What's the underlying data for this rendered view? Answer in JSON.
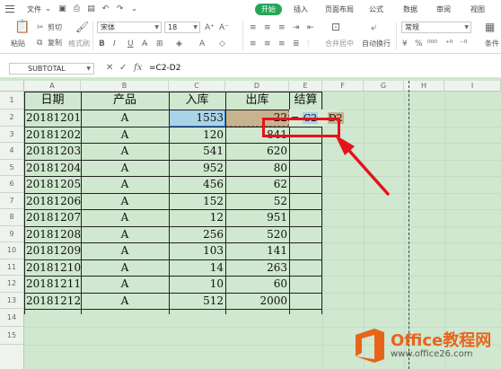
{
  "menubar": {
    "file_label": "文件",
    "tabs": [
      {
        "label": "开始",
        "active": true
      },
      {
        "label": "插入",
        "active": false
      },
      {
        "label": "页面布局",
        "active": false
      },
      {
        "label": "公式",
        "active": false
      },
      {
        "label": "数据",
        "active": false
      },
      {
        "label": "审阅",
        "active": false
      },
      {
        "label": "视图",
        "active": false
      }
    ]
  },
  "ribbon": {
    "paste_label": "粘贴",
    "cut_label": "剪切",
    "copy_label": "复制",
    "format_painter_label": "格式刷",
    "font_name": "宋体",
    "font_size": "18",
    "merge_label": "合并居中",
    "wrap_label": "自动换行",
    "number_format": "常规",
    "condition_label": "条件"
  },
  "formula_bar": {
    "name_box": "SUBTOTAL",
    "fx_label": "fx",
    "formula": "=C2-D2"
  },
  "columns": [
    "A",
    "B",
    "C",
    "D",
    "E",
    "F",
    "G",
    "H",
    "I"
  ],
  "rows": [
    "1",
    "2",
    "3",
    "4",
    "5",
    "6",
    "7",
    "8",
    "9",
    "10",
    "11",
    "12",
    "13",
    "14",
    "15"
  ],
  "table": {
    "headers": [
      "日期",
      "产品",
      "入库",
      "出库",
      "结算"
    ],
    "data": [
      [
        "20181201",
        "A",
        "1553",
        "22"
      ],
      [
        "20181202",
        "A",
        "120",
        "841"
      ],
      [
        "20181203",
        "A",
        "541",
        "620"
      ],
      [
        "20181204",
        "A",
        "952",
        "80"
      ],
      [
        "20181205",
        "A",
        "456",
        "62"
      ],
      [
        "20181206",
        "A",
        "152",
        "52"
      ],
      [
        "20181207",
        "A",
        "12",
        "951"
      ],
      [
        "20181208",
        "A",
        "256",
        "520"
      ],
      [
        "20181209",
        "A",
        "103",
        "141"
      ],
      [
        "20181210",
        "A",
        "14",
        "263"
      ],
      [
        "20181211",
        "A",
        "10",
        "60"
      ],
      [
        "20181212",
        "A",
        "512",
        "2000"
      ]
    ]
  },
  "editing_cell": {
    "eq": "=",
    "ref1": "C2",
    "op": "-",
    "ref2": "D2"
  },
  "logo": {
    "text": "Office教程网",
    "url": "www.office26.com"
  },
  "colors": {
    "accent": "#26a557",
    "sheet_bg": "#cfe8cf",
    "annotation": "#e5131b",
    "logo_orange": "#e8641b"
  }
}
